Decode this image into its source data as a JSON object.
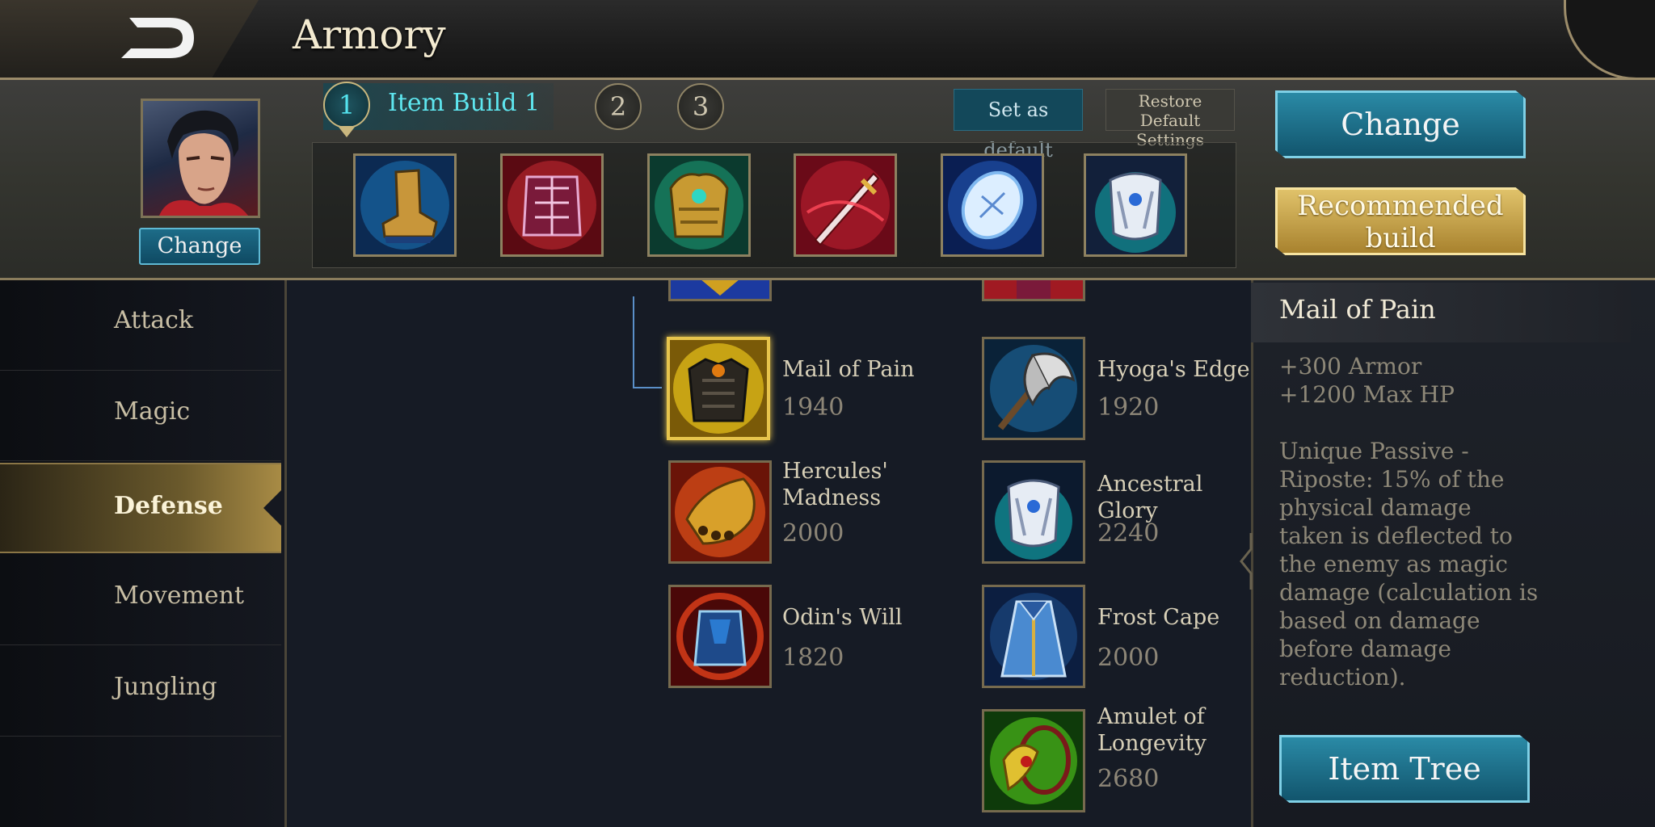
{
  "header": {
    "title": "Armory"
  },
  "hero": {
    "change_label": "Change"
  },
  "builds": {
    "tabs": [
      "1",
      "2",
      "3"
    ],
    "active_label": "Item Build 1",
    "set_default": "Set as default",
    "restore_default": [
      "Restore Default",
      "Settings"
    ]
  },
  "build_items": [
    {
      "icon": "boots-icon",
      "color": "#1a6fb0"
    },
    {
      "icon": "gauntlet-icon",
      "color": "#b0242c"
    },
    {
      "icon": "golden-armor-icon",
      "color": "#1a8a6a"
    },
    {
      "icon": "crimson-blade-icon",
      "color": "#b01c2c"
    },
    {
      "icon": "frost-shield-icon",
      "color": "#1e4ea8"
    },
    {
      "icon": "ancestral-armor-icon",
      "color": "#10a6a8"
    }
  ],
  "actions": {
    "change": "Change",
    "recommended": [
      "Recommended",
      "build"
    ]
  },
  "categories": [
    {
      "label": "Attack",
      "active": false
    },
    {
      "label": "Magic",
      "active": false
    },
    {
      "label": "Defense",
      "active": true
    },
    {
      "label": "Movement",
      "active": false
    },
    {
      "label": "Jungling",
      "active": false
    }
  ],
  "items_left": [
    {
      "name": [
        "Mail of Pain"
      ],
      "price": "1940",
      "icon": "mail-of-pain-icon",
      "color": "#c9a51a"
    },
    {
      "name": [
        "Hercules'",
        "Madness"
      ],
      "price": "2000",
      "icon": "hercules-madness-icon",
      "color": "#c6401a"
    },
    {
      "name": [
        "Odin's Will"
      ],
      "price": "1820",
      "icon": "odins-will-icon",
      "color": "#a51e1e"
    }
  ],
  "items_right": [
    {
      "name": [
        "Hyoga's Edge"
      ],
      "price": "1920",
      "icon": "hyogas-edge-icon",
      "color": "#1e6aa0"
    },
    {
      "name": [
        "Ancestral Glory"
      ],
      "price": "2240",
      "icon": "ancestral-glory-icon",
      "color": "#12808a"
    },
    {
      "name": [
        "Frost Cape"
      ],
      "price": "2000",
      "icon": "frost-cape-icon",
      "color": "#1e4c8a"
    },
    {
      "name": [
        "Amulet of",
        "Longevity"
      ],
      "price": "2680",
      "icon": "amulet-of-longevity-icon",
      "color": "#3a9a1a"
    }
  ],
  "detail": {
    "title": "Mail of Pain",
    "stats": [
      "+300 Armor",
      "+1200 Max HP"
    ],
    "description": [
      "Unique Passive -",
      "Riposte: 15% of the",
      "physical damage",
      "taken is deflected to",
      "the enemy as magic",
      "damage (calculation is",
      "based on damage",
      "before damage",
      "reduction)."
    ],
    "item_tree": "Item Tree"
  }
}
